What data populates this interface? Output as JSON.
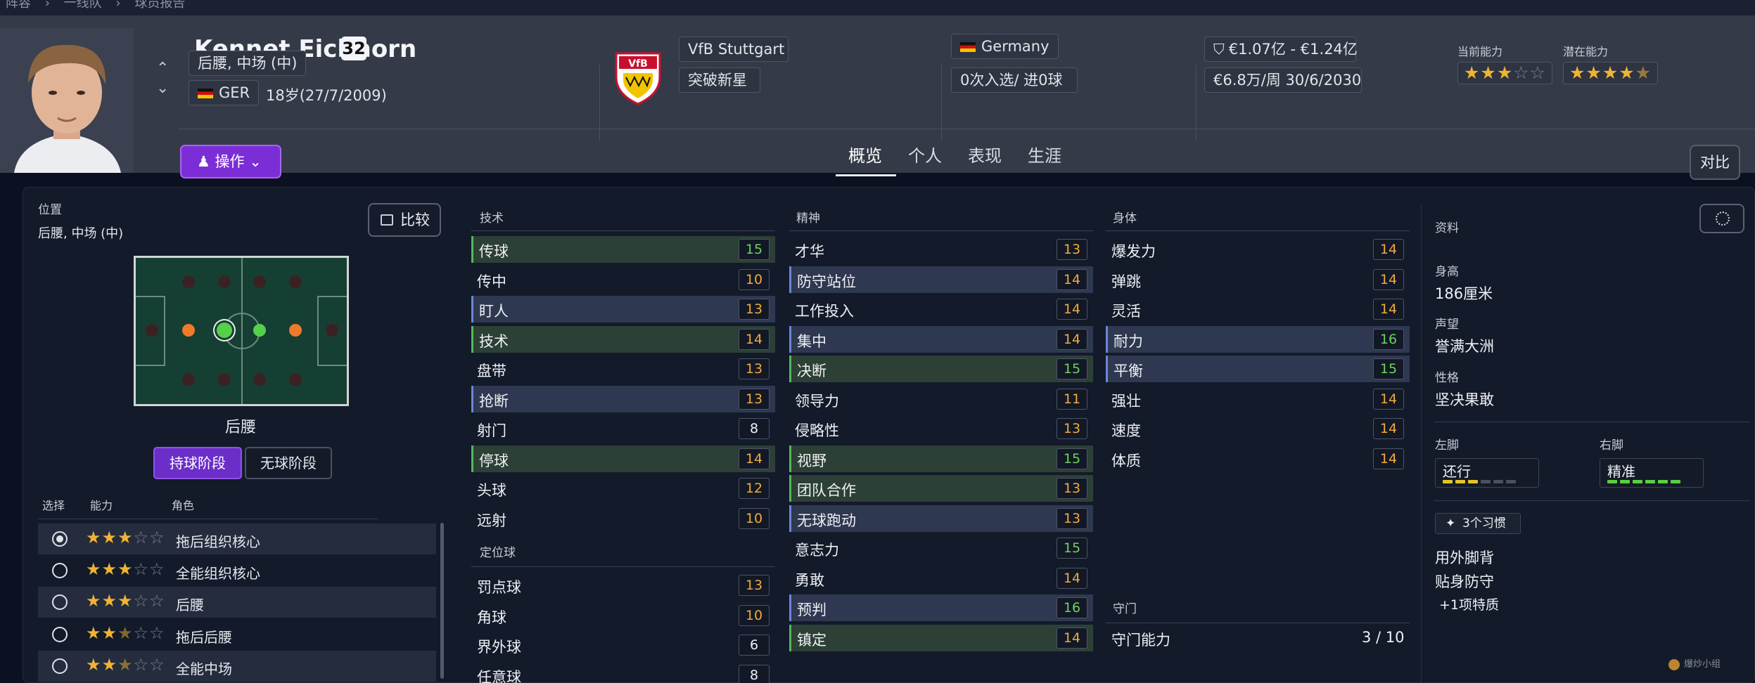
{
  "breadcrumb": [
    "阵容",
    "一线队",
    "球员报告"
  ],
  "player": {
    "name": "Kennet Eichhorn",
    "number": "32",
    "position": "后腰, 中场 (中)",
    "nationality_code": "GER",
    "age_birth": "18岁(27/7/2009)"
  },
  "actions_label": "操作",
  "club": {
    "name": "VfB Stuttgart",
    "status": "突破新星"
  },
  "nation": {
    "name": "Germany",
    "caps": "0次入选/ 进0球"
  },
  "contract": {
    "value": "€1.07亿 - €1.24亿",
    "wage": "€6.8万/周 30/6/2030"
  },
  "ability": {
    "current_label": "当前能力",
    "current_stars": 3,
    "potential_label": "潜在能力",
    "potential_stars": 4.5
  },
  "tabs": [
    "概览",
    "个人",
    "表现",
    "生涯"
  ],
  "active_tab": 0,
  "compare_label": "对比",
  "left_panel": {
    "title": "位置",
    "positions": "后腰, 中场 (中)",
    "compare_btn": "比较",
    "selected_position": "后腰",
    "phase_in": "持球阶段",
    "phase_out": "无球阶段",
    "headers": {
      "select": "选择",
      "ability": "能力",
      "role": "角色"
    },
    "roles": [
      {
        "name": "拖后组织核心",
        "stars": 3,
        "selected": true
      },
      {
        "name": "全能组织核心",
        "stars": 3,
        "selected": false
      },
      {
        "name": "后腰",
        "stars": 3,
        "selected": false
      },
      {
        "name": "拖后后腰",
        "stars": 2.5,
        "selected": false
      },
      {
        "name": "全能中场",
        "stars": 2.5,
        "selected": false
      }
    ]
  },
  "technical": {
    "title": "技术",
    "items": [
      {
        "name": "传球",
        "value": "15",
        "color": "G",
        "hl": "g"
      },
      {
        "name": "传中",
        "value": "10",
        "color": "O",
        "hl": ""
      },
      {
        "name": "盯人",
        "value": "13",
        "color": "O",
        "hl": "b"
      },
      {
        "name": "技术",
        "value": "14",
        "color": "O",
        "hl": "g"
      },
      {
        "name": "盘带",
        "value": "13",
        "color": "O",
        "hl": ""
      },
      {
        "name": "抢断",
        "value": "13",
        "color": "O",
        "hl": "b"
      },
      {
        "name": "射门",
        "value": "8",
        "color": "W",
        "hl": ""
      },
      {
        "name": "停球",
        "value": "14",
        "color": "O",
        "hl": "g"
      },
      {
        "name": "头球",
        "value": "12",
        "color": "O",
        "hl": ""
      },
      {
        "name": "远射",
        "value": "10",
        "color": "O",
        "hl": ""
      }
    ]
  },
  "set_pieces": {
    "title": "定位球",
    "items": [
      {
        "name": "罚点球",
        "value": "13",
        "color": "O",
        "hl": ""
      },
      {
        "name": "角球",
        "value": "10",
        "color": "O",
        "hl": ""
      },
      {
        "name": "界外球",
        "value": "6",
        "color": "W",
        "hl": ""
      },
      {
        "name": "任意球",
        "value": "8",
        "color": "W",
        "hl": ""
      }
    ]
  },
  "mental": {
    "title": "精神",
    "items": [
      {
        "name": "才华",
        "value": "13",
        "color": "O",
        "hl": ""
      },
      {
        "name": "防守站位",
        "value": "14",
        "color": "O",
        "hl": "b"
      },
      {
        "name": "工作投入",
        "value": "14",
        "color": "O",
        "hl": ""
      },
      {
        "name": "集中",
        "value": "14",
        "color": "O",
        "hl": "b"
      },
      {
        "name": "决断",
        "value": "15",
        "color": "G",
        "hl": "g"
      },
      {
        "name": "领导力",
        "value": "11",
        "color": "O",
        "hl": ""
      },
      {
        "name": "侵略性",
        "value": "13",
        "color": "O",
        "hl": ""
      },
      {
        "name": "视野",
        "value": "15",
        "color": "G",
        "hl": "g"
      },
      {
        "name": "团队合作",
        "value": "13",
        "color": "O",
        "hl": "g"
      },
      {
        "name": "无球跑动",
        "value": "13",
        "color": "O",
        "hl": "b"
      },
      {
        "name": "意志力",
        "value": "15",
        "color": "G",
        "hl": ""
      },
      {
        "name": "勇敢",
        "value": "14",
        "color": "O",
        "hl": ""
      },
      {
        "name": "预判",
        "value": "16",
        "color": "G",
        "hl": "b"
      },
      {
        "name": "镇定",
        "value": "14",
        "color": "O",
        "hl": "g"
      }
    ]
  },
  "physical": {
    "title": "身体",
    "items": [
      {
        "name": "爆发力",
        "value": "14",
        "color": "O",
        "hl": ""
      },
      {
        "name": "弹跳",
        "value": "14",
        "color": "O",
        "hl": ""
      },
      {
        "name": "灵活",
        "value": "14",
        "color": "O",
        "hl": ""
      },
      {
        "name": "耐力",
        "value": "16",
        "color": "G",
        "hl": "b"
      },
      {
        "name": "平衡",
        "value": "15",
        "color": "G",
        "hl": "b"
      },
      {
        "name": "强壮",
        "value": "14",
        "color": "O",
        "hl": ""
      },
      {
        "name": "速度",
        "value": "14",
        "color": "O",
        "hl": ""
      },
      {
        "name": "体质",
        "value": "14",
        "color": "O",
        "hl": ""
      }
    ]
  },
  "goalkeeping": {
    "title": "守门",
    "label": "守门能力",
    "value": "3 / 10"
  },
  "profile": {
    "title": "资料",
    "height_label": "身高",
    "height": "186厘米",
    "rep_label": "声望",
    "rep": "誉满大洲",
    "pers_label": "性格",
    "pers": "坚决果敢",
    "left_foot_label": "左脚",
    "left_foot": "还行",
    "left_foot_level": 3,
    "right_foot_label": "右脚",
    "right_foot": "精准",
    "right_foot_level": 6,
    "habits": "3个习惯",
    "habit_list": [
      "用外脚背",
      "贴身防守",
      "+1项特质"
    ]
  },
  "watermark": "爆炒小组"
}
